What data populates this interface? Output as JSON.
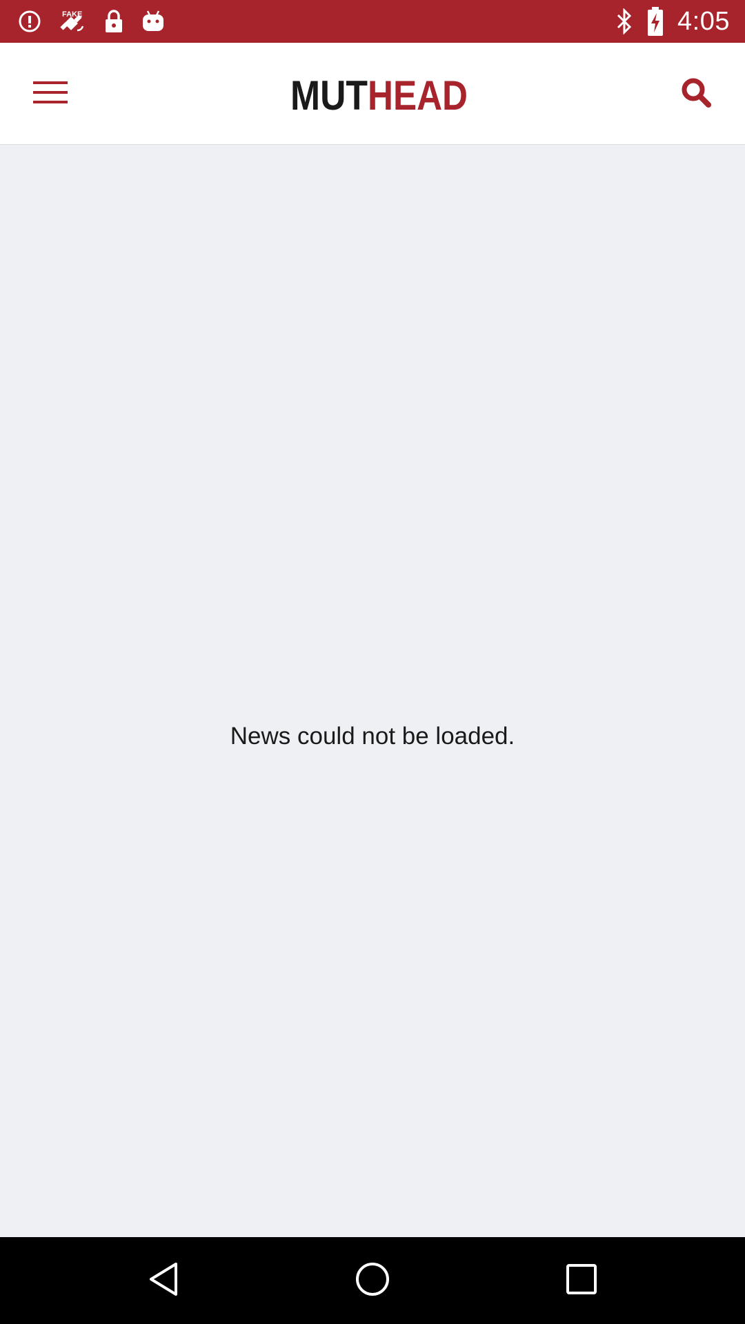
{
  "status_bar": {
    "time": "4:05",
    "left_icons": [
      "alert-icon",
      "fake-gps-icon",
      "lock-icon",
      "android-icon"
    ],
    "right_icons": [
      "bluetooth-icon",
      "battery-charging-icon"
    ]
  },
  "app_bar": {
    "logo_text_dark": "MUT",
    "logo_text_red": "HEAD",
    "menu_icon": "hamburger-menu-icon",
    "search_icon": "search-icon"
  },
  "content": {
    "empty_message": "News could not be loaded."
  },
  "nav_bar": {
    "buttons": [
      "back-icon",
      "home-icon",
      "recents-icon"
    ]
  },
  "colors": {
    "brand_red": "#a7242c",
    "logo_dark": "#1a1a1a",
    "background": "#eff0f4"
  }
}
